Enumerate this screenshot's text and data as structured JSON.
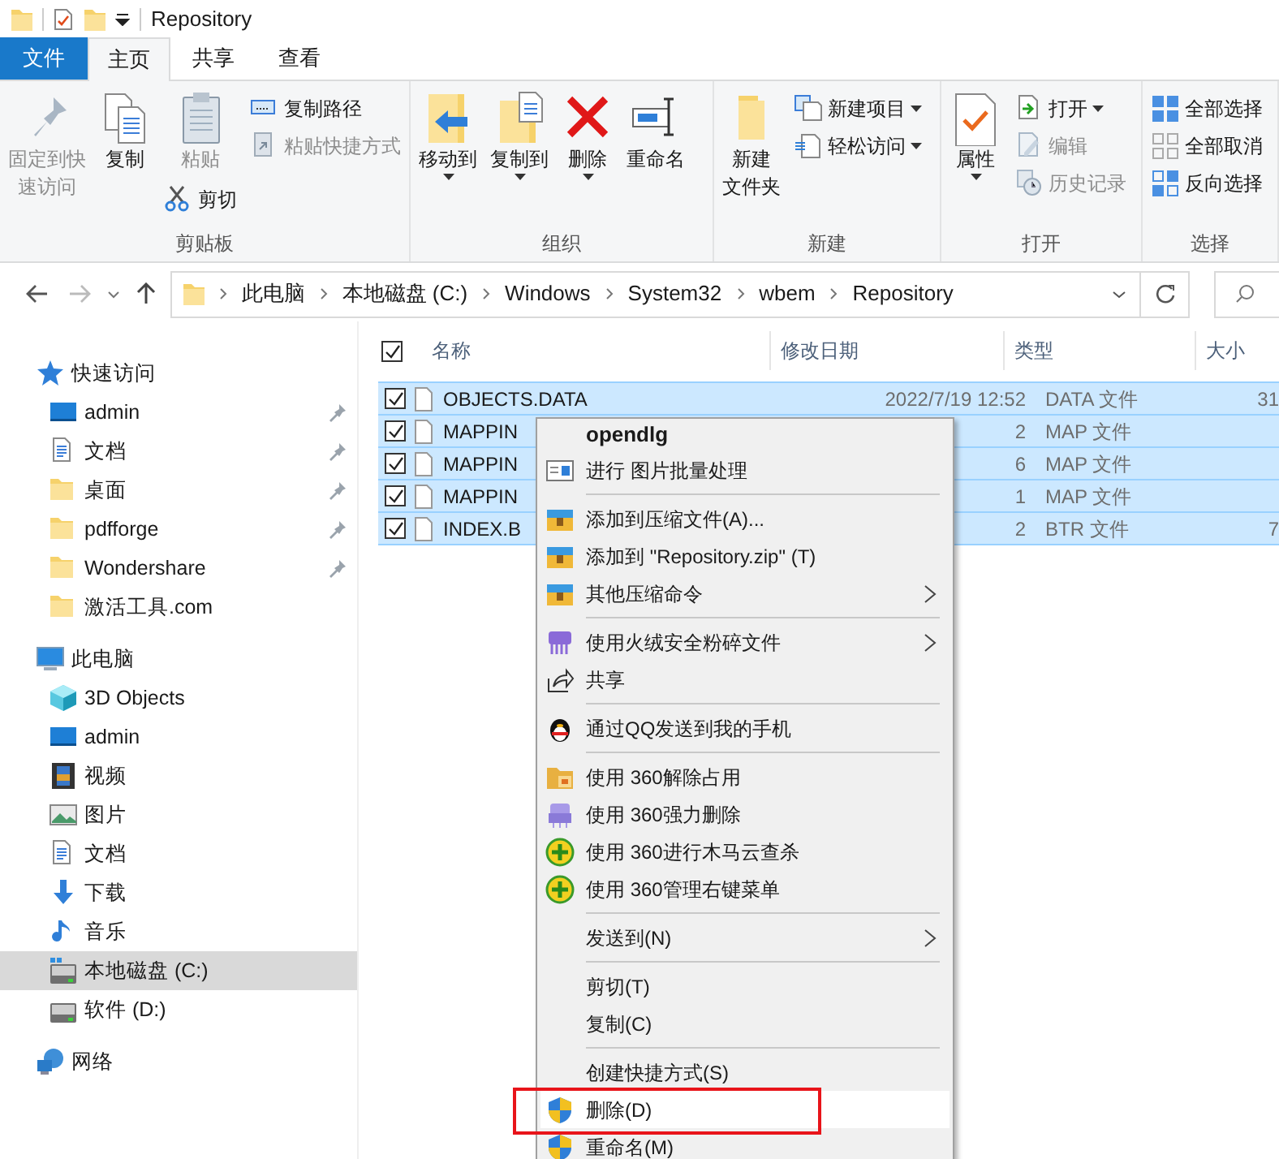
{
  "window": {
    "title": "Repository"
  },
  "ribbon_tabs": [
    {
      "label": "文件",
      "kind": "file",
      "selected": false
    },
    {
      "label": "主页",
      "kind": "tab",
      "selected": true
    },
    {
      "label": "共享",
      "kind": "tab",
      "selected": false
    },
    {
      "label": "查看",
      "kind": "tab",
      "selected": false
    }
  ],
  "ribbon": {
    "groups": [
      {
        "label": "剪贴板",
        "columns": [
          [
            {
              "kind": "large",
              "lines": [
                "固定到快",
                "速访问"
              ],
              "disabled": true,
              "dropdown": false
            }
          ],
          [
            {
              "kind": "large",
              "lines": [
                "复制"
              ],
              "disabled": false,
              "dropdown": false
            }
          ],
          [
            {
              "kind": "large",
              "lines": [
                "粘贴"
              ],
              "disabled": true,
              "dropdown": false
            },
            {
              "kind": "small",
              "lines": [
                "剪切"
              ],
              "disabled": false,
              "dropdown": false
            }
          ],
          [
            {
              "kind": "small",
              "lines": [
                "复制路径"
              ],
              "disabled": false,
              "dropdown": false
            },
            {
              "kind": "small",
              "lines": [
                "粘贴快捷方式"
              ],
              "disabled": true,
              "dropdown": false
            }
          ]
        ]
      },
      {
        "label": "组织",
        "columns": [
          [
            {
              "kind": "large",
              "lines": [
                "移动到"
              ],
              "disabled": false,
              "dropdown": true
            }
          ],
          [
            {
              "kind": "large",
              "lines": [
                "复制到"
              ],
              "disabled": false,
              "dropdown": true
            }
          ],
          [
            {
              "kind": "large",
              "lines": [
                "删除"
              ],
              "disabled": false,
              "dropdown": true
            }
          ],
          [
            {
              "kind": "large",
              "lines": [
                "重命名"
              ],
              "disabled": false,
              "dropdown": false
            }
          ]
        ]
      },
      {
        "label": "新建",
        "columns": [
          [
            {
              "kind": "large",
              "lines": [
                "新建",
                "文件夹"
              ],
              "disabled": false,
              "dropdown": false
            }
          ],
          [
            {
              "kind": "small",
              "lines": [
                "新建项目"
              ],
              "disabled": false,
              "dropdown": true
            },
            {
              "kind": "small",
              "lines": [
                "轻松访问"
              ],
              "disabled": false,
              "dropdown": true
            }
          ]
        ]
      },
      {
        "label": "打开",
        "columns": [
          [
            {
              "kind": "large",
              "lines": [
                "属性"
              ],
              "disabled": false,
              "dropdown": true
            }
          ],
          [
            {
              "kind": "small",
              "lines": [
                "打开"
              ],
              "disabled": false,
              "dropdown": true
            },
            {
              "kind": "small",
              "lines": [
                "编辑"
              ],
              "disabled": true,
              "dropdown": false
            },
            {
              "kind": "small",
              "lines": [
                "历史记录"
              ],
              "disabled": true,
              "dropdown": false
            }
          ]
        ]
      },
      {
        "label": "选择",
        "columns": [
          [
            {
              "kind": "small",
              "lines": [
                "全部选择"
              ],
              "disabled": false,
              "dropdown": false
            },
            {
              "kind": "small",
              "lines": [
                "全部取消"
              ],
              "disabled": false,
              "dropdown": false
            },
            {
              "kind": "small",
              "lines": [
                "反向选择"
              ],
              "disabled": false,
              "dropdown": false
            }
          ]
        ]
      }
    ]
  },
  "address_bar": {
    "path": [
      "此电脑",
      "本地磁盘 (C:)",
      "Windows",
      "System32",
      "wbem",
      "Repository"
    ]
  },
  "navigation": [
    {
      "label": "快速访问",
      "selected": false,
      "children": [
        {
          "label": "admin",
          "pinned": true,
          "selected": false
        },
        {
          "label": "文档",
          "pinned": true,
          "selected": false
        },
        {
          "label": "桌面",
          "pinned": true,
          "selected": false
        },
        {
          "label": "pdfforge",
          "pinned": true,
          "selected": false
        },
        {
          "label": "Wondershare",
          "pinned": true,
          "selected": false
        },
        {
          "label": "激活工具.com",
          "pinned": false,
          "selected": false
        }
      ]
    },
    {
      "label": "此电脑",
      "selected": false,
      "children": [
        {
          "label": "3D Objects",
          "pinned": false,
          "selected": false
        },
        {
          "label": "admin",
          "pinned": false,
          "selected": false
        },
        {
          "label": "视频",
          "pinned": false,
          "selected": false
        },
        {
          "label": "图片",
          "pinned": false,
          "selected": false
        },
        {
          "label": "文档",
          "pinned": false,
          "selected": false
        },
        {
          "label": "下载",
          "pinned": false,
          "selected": false
        },
        {
          "label": "音乐",
          "pinned": false,
          "selected": false
        },
        {
          "label": "本地磁盘 (C:)",
          "pinned": false,
          "selected": true
        },
        {
          "label": "软件 (D:)",
          "pinned": false,
          "selected": false
        }
      ]
    },
    {
      "label": "网络",
      "selected": false
    }
  ],
  "file_list": {
    "select_all_checked": true,
    "columns": [
      "名称",
      "修改日期",
      "类型",
      "大小"
    ],
    "rows": [
      {
        "name": "OBJECTS.DATA",
        "date": "2022/7/19 12:52",
        "type": "DATA 文件",
        "size": "31",
        "checked": true,
        "selected": true
      },
      {
        "name": "MAPPIN",
        "date": "2",
        "type": "MAP 文件",
        "checked": true,
        "selected": true
      },
      {
        "name": "MAPPIN",
        "date": "6",
        "type": "MAP 文件",
        "checked": true,
        "selected": true
      },
      {
        "name": "MAPPIN",
        "date": "1",
        "type": "MAP 文件",
        "checked": true,
        "selected": true
      },
      {
        "name": "INDEX.B",
        "date": "2",
        "type": "BTR 文件",
        "size": "7",
        "checked": true,
        "selected": true
      }
    ]
  },
  "context_menu": {
    "items": [
      {
        "kind": "header",
        "label": "opendlg",
        "submenu": false,
        "highlighted": false
      },
      {
        "kind": "item",
        "label": "进行 图片批量处理",
        "submenu": false,
        "highlighted": false
      },
      {
        "kind": "separator"
      },
      {
        "kind": "item",
        "label": "添加到压缩文件(A)...",
        "submenu": false,
        "highlighted": false
      },
      {
        "kind": "item",
        "label": "添加到 \"Repository.zip\" (T)",
        "submenu": false,
        "highlighted": false
      },
      {
        "kind": "item",
        "label": "其他压缩命令",
        "submenu": true,
        "highlighted": false
      },
      {
        "kind": "separator"
      },
      {
        "kind": "item",
        "label": "使用火绒安全粉碎文件",
        "submenu": true,
        "highlighted": false
      },
      {
        "kind": "item",
        "label": "共享",
        "submenu": false,
        "highlighted": false
      },
      {
        "kind": "separator"
      },
      {
        "kind": "item",
        "label": "通过QQ发送到我的手机",
        "submenu": false,
        "highlighted": false
      },
      {
        "kind": "separator"
      },
      {
        "kind": "item",
        "label": "使用 360解除占用",
        "submenu": false,
        "highlighted": false
      },
      {
        "kind": "item",
        "label": "使用 360强力删除",
        "submenu": false,
        "highlighted": false
      },
      {
        "kind": "item",
        "label": "使用 360进行木马云查杀",
        "submenu": false,
        "highlighted": false
      },
      {
        "kind": "item",
        "label": "使用 360管理右键菜单",
        "submenu": false,
        "highlighted": false
      },
      {
        "kind": "separator"
      },
      {
        "kind": "item",
        "label": "发送到(N)",
        "submenu": true,
        "highlighted": false
      },
      {
        "kind": "separator"
      },
      {
        "kind": "item",
        "label": "剪切(T)",
        "submenu": false,
        "highlighted": false
      },
      {
        "kind": "item",
        "label": "复制(C)",
        "submenu": false,
        "highlighted": false
      },
      {
        "kind": "separator"
      },
      {
        "kind": "item",
        "label": "创建快捷方式(S)",
        "submenu": false,
        "highlighted": false
      },
      {
        "kind": "item",
        "label": "删除(D)",
        "submenu": false,
        "highlighted": true
      },
      {
        "kind": "item",
        "label": "重命名(M)",
        "submenu": false,
        "highlighted": false
      }
    ]
  }
}
